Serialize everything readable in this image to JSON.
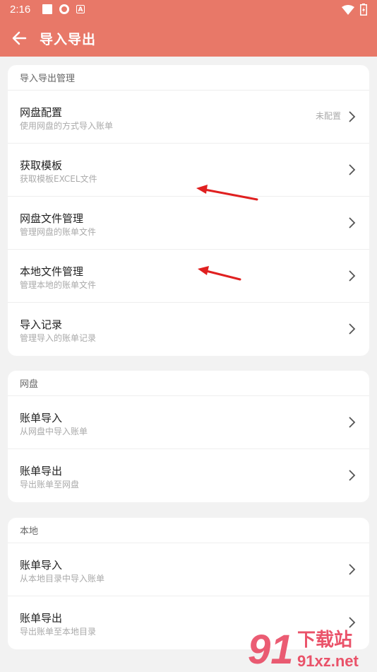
{
  "status": {
    "time": "2:16"
  },
  "appbar": {
    "title": "导入导出"
  },
  "sections": [
    {
      "header": "导入导出管理",
      "items": [
        {
          "title": "网盘配置",
          "subtitle": "使用网盘的方式导入账单",
          "value": "未配置"
        },
        {
          "title": "获取模板",
          "subtitle": "获取模板EXCEL文件"
        },
        {
          "title": "网盘文件管理",
          "subtitle": "管理网盘的账单文件"
        },
        {
          "title": "本地文件管理",
          "subtitle": "管理本地的账单文件"
        },
        {
          "title": "导入记录",
          "subtitle": "管理导入的账单记录"
        }
      ]
    },
    {
      "header": "网盘",
      "items": [
        {
          "title": "账单导入",
          "subtitle": "从网盘中导入账单"
        },
        {
          "title": "账单导出",
          "subtitle": "导出账单至网盘"
        }
      ]
    },
    {
      "header": "本地",
      "items": [
        {
          "title": "账单导入",
          "subtitle": "从本地目录中导入账单"
        },
        {
          "title": "账单导出",
          "subtitle": "导出账单至本地目录"
        }
      ]
    }
  ],
  "watermark": {
    "brand": "下载站",
    "site": "91xz.net"
  },
  "colors": {
    "accent": "#e87868",
    "annotation": "#e02020"
  }
}
